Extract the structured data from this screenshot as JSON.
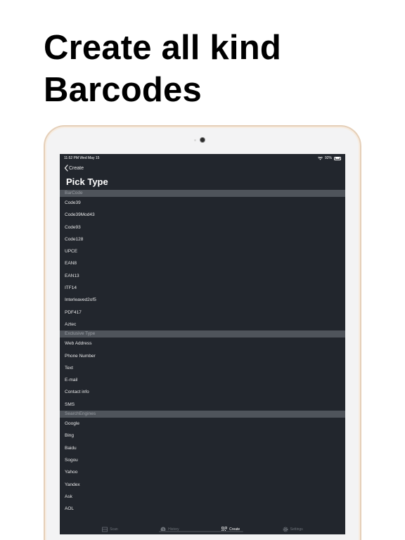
{
  "headline": {
    "line1": "Create all kind",
    "line2": "Barcodes"
  },
  "status_bar": {
    "time": "11:52 PM  Wed May 15",
    "battery": "92%"
  },
  "nav": {
    "back_label": "Create",
    "title": "Pick Type"
  },
  "sections": [
    {
      "header": "BarCode",
      "items": [
        "Code39",
        "Code39Mod43",
        "Code93",
        "Code128",
        "UPCE",
        "EAN8",
        "EAN13",
        "ITF14",
        "Interleaved2of5",
        "PDF417",
        "Aztec"
      ]
    },
    {
      "header": "Exclusive Type",
      "items": [
        "Web Address",
        "Phone Number",
        "Text",
        "E-mail",
        "Contact info",
        "SMS"
      ]
    },
    {
      "header": "SearchEngines",
      "items": [
        "Google",
        "Bing",
        "Baidu",
        "Sogou",
        "Yahoo",
        "Yandex",
        "Ask",
        "AOL"
      ]
    }
  ],
  "tabs": [
    {
      "label": "Scan",
      "icon": "scan-icon",
      "active": false
    },
    {
      "label": "History",
      "icon": "clock-icon",
      "active": false
    },
    {
      "label": "Create",
      "icon": "qr-code-icon",
      "active": true
    },
    {
      "label": "Settings",
      "icon": "gear-icon",
      "active": false
    }
  ],
  "colors": {
    "screen_bg": "#22262d",
    "section_header_bg": "#4f545b",
    "device_frame": "#e5cfb8"
  }
}
